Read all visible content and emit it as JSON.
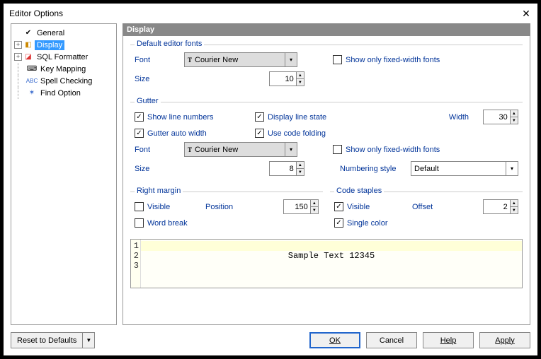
{
  "window": {
    "title": "Editor Options"
  },
  "tree": {
    "items": [
      {
        "label": "General"
      },
      {
        "label": "Display"
      },
      {
        "label": "SQL Formatter"
      },
      {
        "label": "Key Mapping"
      },
      {
        "label": "Spell Checking"
      },
      {
        "label": "Find Option"
      }
    ]
  },
  "header": "Display",
  "groups": {
    "default_fonts": {
      "title": "Default editor fonts",
      "font_label": "Font",
      "font_value": "Courier New",
      "size_label": "Size",
      "size_value": "10",
      "fixed_only_label": "Show only fixed-width fonts",
      "fixed_only_checked": false
    },
    "gutter": {
      "title": "Gutter",
      "show_line_numbers": {
        "label": "Show line numbers",
        "checked": true
      },
      "gutter_auto_width": {
        "label": "Gutter auto width",
        "checked": true
      },
      "display_line_state": {
        "label": "Display line state",
        "checked": true
      },
      "use_code_folding": {
        "label": "Use code folding",
        "checked": true
      },
      "width_label": "Width",
      "width_value": "30",
      "font_label": "Font",
      "font_value": "Courier New",
      "fixed_only_label": "Show only fixed-width fonts",
      "fixed_only_checked": false,
      "size_label": "Size",
      "size_value": "8",
      "numbering_label": "Numbering style",
      "numbering_value": "Default"
    },
    "right_margin": {
      "title": "Right margin",
      "visible": {
        "label": "Visible",
        "checked": false
      },
      "word_break": {
        "label": "Word break",
        "checked": false
      },
      "position_label": "Position",
      "position_value": "150"
    },
    "code_staples": {
      "title": "Code staples",
      "visible": {
        "label": "Visible",
        "checked": true
      },
      "single_color": {
        "label": "Single color",
        "checked": true
      },
      "offset_label": "Offset",
      "offset_value": "2"
    }
  },
  "sample": {
    "lines": [
      "1",
      "2",
      "3"
    ],
    "text": "Sample Text 12345"
  },
  "footer": {
    "reset": "Reset to Defaults",
    "ok": "OK",
    "cancel": "Cancel",
    "help": "Help",
    "apply": "Apply"
  }
}
